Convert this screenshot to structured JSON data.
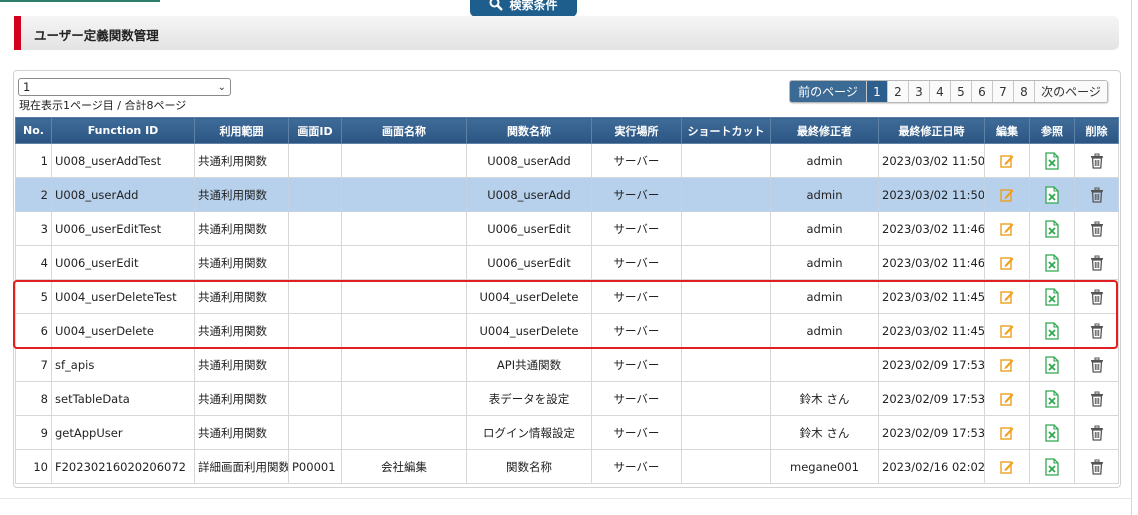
{
  "search_tab_label": "検索条件",
  "page_title": "ユーザー定義関数管理",
  "page_select_value": "1",
  "page_info": "現在表示1ページ目 / 合計8ページ",
  "pager": {
    "prev": "前のページ",
    "pages": [
      "1",
      "2",
      "3",
      "4",
      "5",
      "6",
      "7",
      "8"
    ],
    "active": "1",
    "next": "次のページ"
  },
  "columns": [
    "No.",
    "Function ID",
    "利用範囲",
    "画面ID",
    "画面名称",
    "関数名称",
    "実行場所",
    "ショートカット",
    "最終修正者",
    "最終修正日時",
    "編集",
    "参照",
    "削除"
  ],
  "rows": [
    {
      "no": "1",
      "fid": "U008_userAddTest",
      "scope": "共通利用関数",
      "screen_id": "",
      "screen_name": "",
      "func_name": "U008_userAdd",
      "place": "サーバー",
      "shortcut": "",
      "modifier": "admin",
      "modified": "2023/03/02 11:50"
    },
    {
      "no": "2",
      "fid": "U008_userAdd",
      "scope": "共通利用関数",
      "screen_id": "",
      "screen_name": "",
      "func_name": "U008_userAdd",
      "place": "サーバー",
      "shortcut": "",
      "modifier": "admin",
      "modified": "2023/03/02 11:50"
    },
    {
      "no": "3",
      "fid": "U006_userEditTest",
      "scope": "共通利用関数",
      "screen_id": "",
      "screen_name": "",
      "func_name": "U006_userEdit",
      "place": "サーバー",
      "shortcut": "",
      "modifier": "admin",
      "modified": "2023/03/02 11:46"
    },
    {
      "no": "4",
      "fid": "U006_userEdit",
      "scope": "共通利用関数",
      "screen_id": "",
      "screen_name": "",
      "func_name": "U006_userEdit",
      "place": "サーバー",
      "shortcut": "",
      "modifier": "admin",
      "modified": "2023/03/02 11:46"
    },
    {
      "no": "5",
      "fid": "U004_userDeleteTest",
      "scope": "共通利用関数",
      "screen_id": "",
      "screen_name": "",
      "func_name": "U004_userDelete",
      "place": "サーバー",
      "shortcut": "",
      "modifier": "admin",
      "modified": "2023/03/02 11:45"
    },
    {
      "no": "6",
      "fid": "U004_userDelete",
      "scope": "共通利用関数",
      "screen_id": "",
      "screen_name": "",
      "func_name": "U004_userDelete",
      "place": "サーバー",
      "shortcut": "",
      "modifier": "admin",
      "modified": "2023/03/02 11:45"
    },
    {
      "no": "7",
      "fid": "sf_apis",
      "scope": "共通利用関数",
      "screen_id": "",
      "screen_name": "",
      "func_name": "API共通関数",
      "place": "サーバー",
      "shortcut": "",
      "modifier": "",
      "modified": "2023/02/09 17:53"
    },
    {
      "no": "8",
      "fid": "setTableData",
      "scope": "共通利用関数",
      "screen_id": "",
      "screen_name": "",
      "func_name": "表データを設定",
      "place": "サーバー",
      "shortcut": "",
      "modifier": "鈴木 さん",
      "modified": "2023/02/09 17:53"
    },
    {
      "no": "9",
      "fid": "getAppUser",
      "scope": "共通利用関数",
      "screen_id": "",
      "screen_name": "",
      "func_name": "ログイン情報設定",
      "place": "サーバー",
      "shortcut": "",
      "modifier": "鈴木 さん",
      "modified": "2023/02/09 17:53"
    },
    {
      "no": "10",
      "fid": "F20230216020206072",
      "scope": "詳細画面利用関数",
      "screen_id": "P00001",
      "screen_name": "会社編集",
      "func_name": "関数名称",
      "place": "サーバー",
      "shortcut": "",
      "modifier": "megane001",
      "modified": "2023/02/16 02:02"
    }
  ],
  "selected_row": "2",
  "colors": {
    "header_bg": "#2b5482",
    "selected_row_bg": "#b7d1ec",
    "title_accent": "#d3001b",
    "edit_icon": "#f0a020",
    "excel_icon": "#2fa84f",
    "highlight_border": "#e0201e"
  },
  "icons": {
    "edit": "edit-icon",
    "refer": "excel-icon",
    "delete": "trash-icon",
    "search": "search-icon"
  }
}
